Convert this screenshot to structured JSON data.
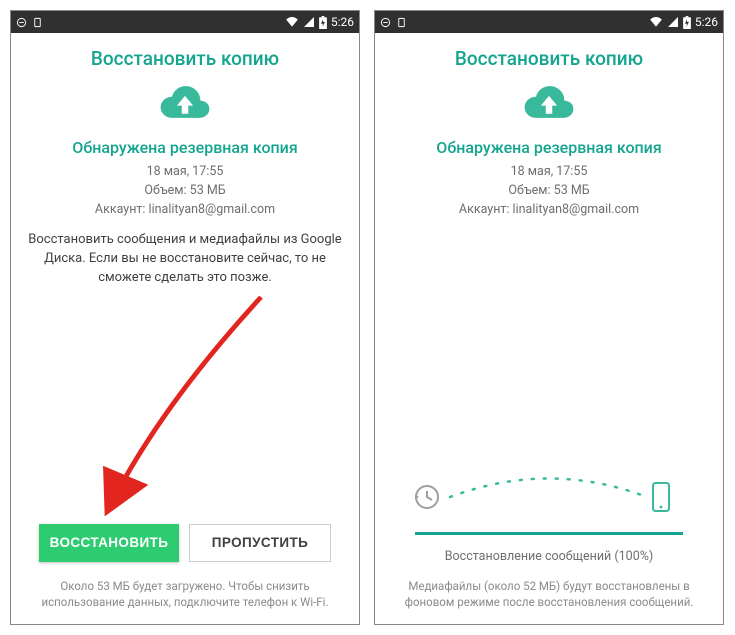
{
  "statusbar": {
    "time": "5:26"
  },
  "left": {
    "title": "Восстановить копию",
    "subtitle": "Обнаружена резервная копия",
    "meta_datetime": "18 мая, 17:55",
    "meta_size": "Объем: 53 МБ",
    "meta_account": "Аккаунт: linalityan8@gmail.com",
    "description": "Восстановить сообщения и медиафайлы из Google Диска. Если вы не восстановите сейчас, то не сможете сделать это позже.",
    "button_restore": "ВОССТАНОВИТЬ",
    "button_skip": "ПРОПУСТИТЬ",
    "footnote": "Около 53 МБ будет загружено. Чтобы снизить использование данных, подключите телефон к Wi-Fi."
  },
  "right": {
    "title": "Восстановить копию",
    "subtitle": "Обнаружена резервная копия",
    "meta_datetime": "18 мая, 17:55",
    "meta_size": "Объем: 53 МБ",
    "meta_account": "Аккаунт: linalityan8@gmail.com",
    "progress_label": "Восстановление сообщений (100%)",
    "progress_percent": 100,
    "footnote": "Медиафайлы (около 52 МБ) будут восстановлены в фоновом режиме после восстановления сообщений."
  }
}
